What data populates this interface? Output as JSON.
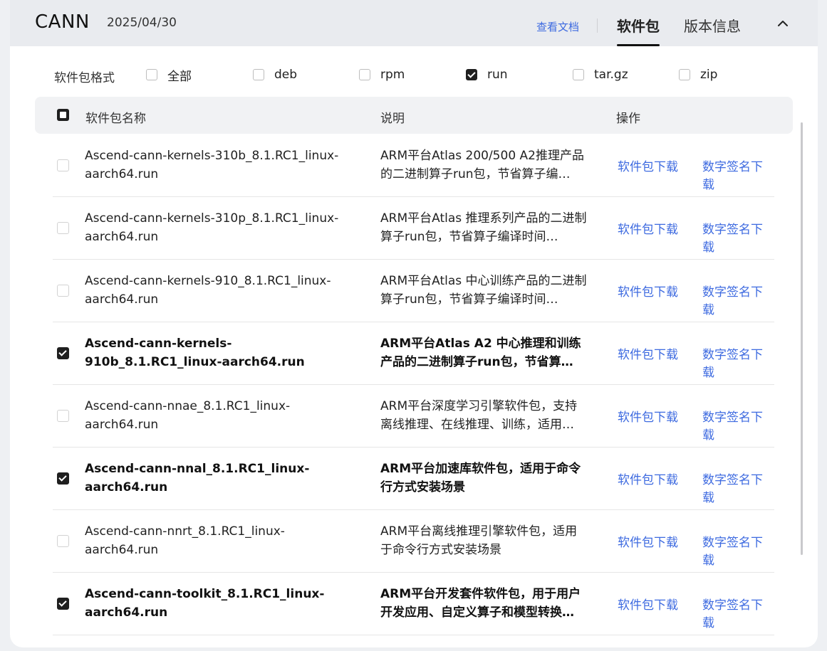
{
  "header": {
    "brand": "CANN",
    "date": "2025/04/30",
    "doc_link": "查看文档",
    "tab_packages": "软件包",
    "tab_version": "版本信息"
  },
  "filter": {
    "label": "软件包格式",
    "options": [
      {
        "label": "全部",
        "checked": false
      },
      {
        "label": "deb",
        "checked": false
      },
      {
        "label": "rpm",
        "checked": false
      },
      {
        "label": "run",
        "checked": true
      },
      {
        "label": "tar.gz",
        "checked": false
      },
      {
        "label": "zip",
        "checked": false
      }
    ]
  },
  "table": {
    "headers": {
      "name": "软件包名称",
      "desc": "说明",
      "ops": "操作"
    },
    "download_label": "软件包下载",
    "signature_label": "数字签名下载",
    "rows": [
      {
        "name": "Ascend-cann-kernels-310b_8.1.RC1_linux-aarch64.run",
        "desc": "ARM平台Atlas 200/500 A2推理产品的二进制算子run包，节省算子编…",
        "checked": false
      },
      {
        "name": "Ascend-cann-kernels-310p_8.1.RC1_linux-aarch64.run",
        "desc": "ARM平台Atlas 推理系列产品的二进制算子run包，节省算子编译时间…",
        "checked": false
      },
      {
        "name": "Ascend-cann-kernels-910_8.1.RC1_linux-aarch64.run",
        "desc": "ARM平台Atlas 中心训练产品的二进制算子run包，节省算子编译时间…",
        "checked": false
      },
      {
        "name": "Ascend-cann-kernels-910b_8.1.RC1_linux-aarch64.run",
        "desc": "ARM平台Atlas A2 中心推理和训练产品的二进制算子run包，节省算…",
        "checked": true
      },
      {
        "name": "Ascend-cann-nnae_8.1.RC1_linux-aarch64.run",
        "desc": "ARM平台深度学习引擎软件包，支持离线推理、在线推理、训练，适用…",
        "checked": false
      },
      {
        "name": "Ascend-cann-nnal_8.1.RC1_linux-aarch64.run",
        "desc": "ARM平台加速库软件包，适用于命令行方式安装场景",
        "checked": true
      },
      {
        "name": "Ascend-cann-nnrt_8.1.RC1_linux-aarch64.run",
        "desc": "ARM平台离线推理引擎软件包，适用于命令行方式安装场景",
        "checked": false
      },
      {
        "name": "Ascend-cann-toolkit_8.1.RC1_linux-aarch64.run",
        "desc": "ARM平台开发套件软件包，用于用户开发应用、自定义算子和模型转换…",
        "checked": true
      }
    ]
  },
  "colors": {
    "accent": "#3d6ae0",
    "header_bg": "#e9ebef",
    "check": "#1f1f1f"
  },
  "icons": {
    "collapse": "chevron-up-icon",
    "checkbox_checked": "check-icon"
  }
}
